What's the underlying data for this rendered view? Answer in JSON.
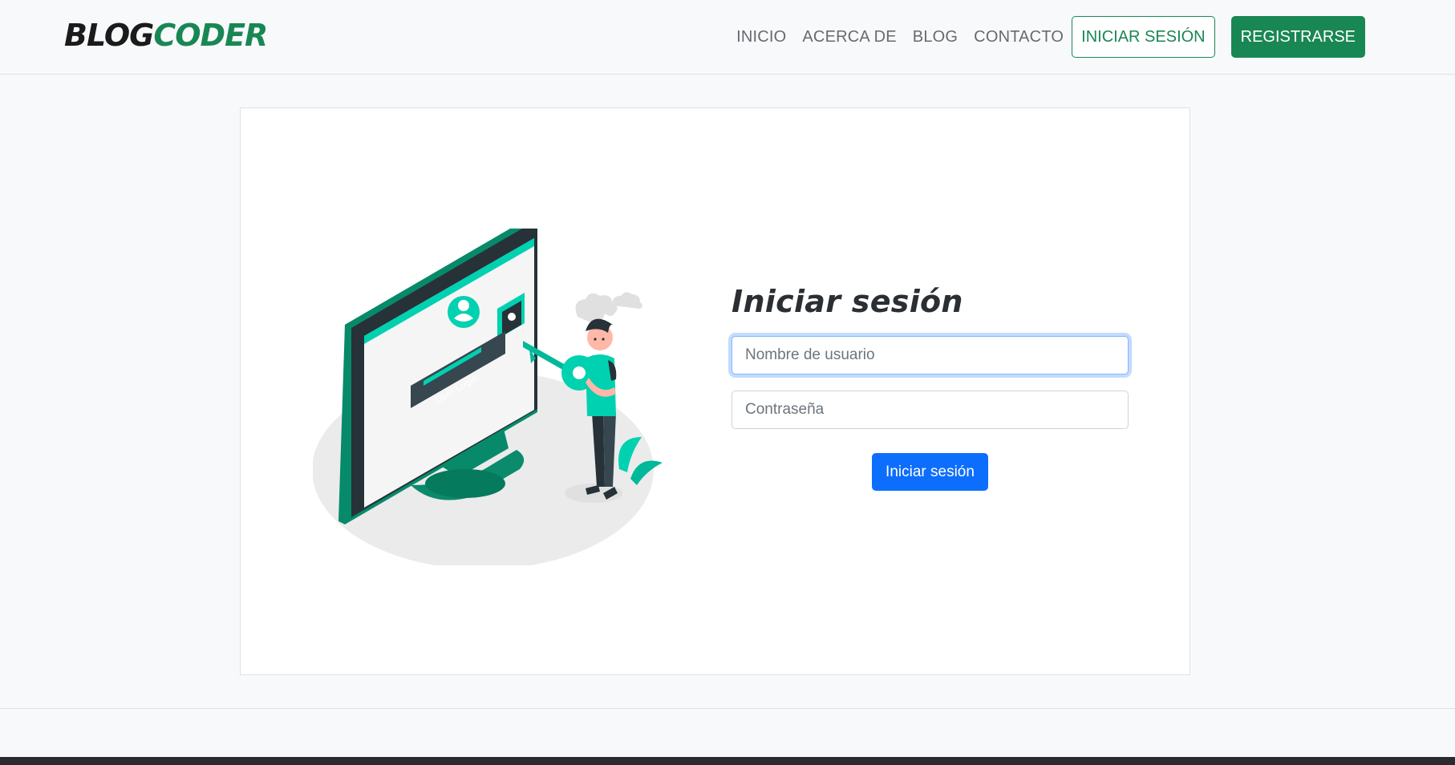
{
  "brand": {
    "part1": "BLOG",
    "part2": "CODER"
  },
  "nav": {
    "links": [
      "INICIO",
      "ACERCA DE",
      "BLOG",
      "CONTACTO"
    ],
    "login_label": "INICIAR SESIÓN",
    "register_label": "REGISTRARSE"
  },
  "illustration": {
    "screen_text": "User Login"
  },
  "form": {
    "title": "Iniciar sesión",
    "username_placeholder": "Nombre de usuario",
    "password_placeholder": "Contraseña",
    "submit_label": "Iniciar sesión"
  },
  "colors": {
    "accent_green": "#198754",
    "primary_blue": "#0d6efd",
    "illustration_teal": "#00d1b0"
  }
}
